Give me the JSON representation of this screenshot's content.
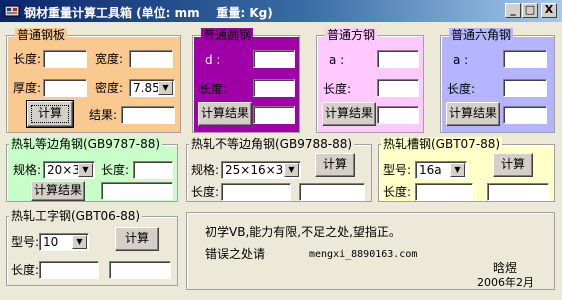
{
  "window": {
    "title": "钢材重量计算工具箱 (单位: mm    重量: Kg)",
    "minimize": "_",
    "maximize": "□",
    "close": "X"
  },
  "plate": {
    "title": "普通钢板",
    "length_label": "长度:",
    "width_label": "宽度:",
    "thickness_label": "厚度:",
    "density_label": "密度:",
    "density_value": "7.85",
    "calc_button": "计算",
    "result_label": "结果:",
    "bg": "#f9c98f"
  },
  "round": {
    "title": "普通圆钢",
    "d_label": "d :",
    "length_label": "长度:",
    "calc_button": "计算结果",
    "bg": "#a000a8"
  },
  "square": {
    "title": "普通方钢",
    "a_label": "a :",
    "length_label": "长度:",
    "calc_button": "计算结果",
    "bg": "#ffc8ff"
  },
  "hex": {
    "title": "普通六角钢",
    "a_label": "a :",
    "length_label": "长度:",
    "calc_button": "计算结果",
    "bg": "#b4b4ff"
  },
  "equal_angle": {
    "title": "热轧等边角钢(GB9787-88)",
    "spec_label": "规格:",
    "spec_value": "20×3",
    "length_label": "长度:",
    "calc_button": "计算结果",
    "bg": "#c8ffc8"
  },
  "unequal_angle": {
    "title": "热轧不等边角钢(GB9788-88)",
    "spec_label": "规格:",
    "spec_value": "25×16×3",
    "length_label": "长度:",
    "calc_button": "计算"
  },
  "channel": {
    "title": "热轧槽钢(GBT07-88)",
    "model_label": "型号:",
    "model_value": "16a",
    "length_label": "长度:",
    "calc_button": "计算",
    "bg": "#ffffc8"
  },
  "ibeam": {
    "title": "热轧工字钢(GBT06-88)",
    "model_label": "型号:",
    "model_value": "10",
    "length_label": "长度:",
    "calc_button": "计算"
  },
  "info": {
    "line1": "初学VB,能力有限,不足之处,望指正。",
    "line2_label": "错误之处请",
    "email": "mengxi_8890163.com",
    "author": "晗煜",
    "date": "2006年2月"
  }
}
